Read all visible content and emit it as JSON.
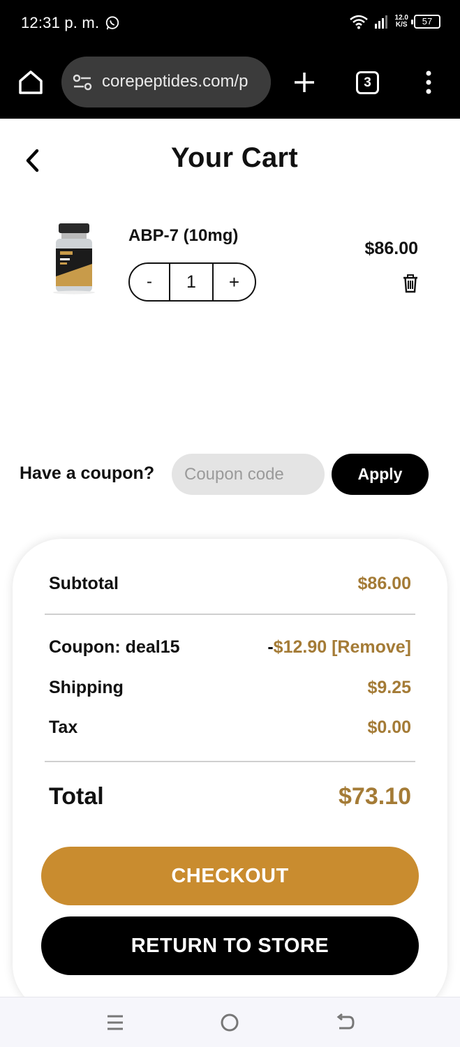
{
  "status_bar": {
    "time": "12:31 p. m.",
    "speed_value": "12.0",
    "speed_unit": "K/S",
    "battery": "57"
  },
  "browser": {
    "url": "corepeptides.com/p",
    "tab_count": "3"
  },
  "header": {
    "title": "Your Cart"
  },
  "cart": {
    "items": [
      {
        "name": "ABP-7 (10mg)",
        "quantity": "1",
        "price": "$86.00",
        "minus": "-",
        "plus": "+"
      }
    ]
  },
  "coupon": {
    "label": "Have a coupon?",
    "placeholder": "Coupon code",
    "apply_label": "Apply"
  },
  "summary": {
    "subtotal_label": "Subtotal",
    "subtotal_value": "$86.00",
    "coupon_label": "Coupon: deal15",
    "coupon_sign": "-",
    "coupon_value": "$12.90 [Remove]",
    "shipping_label": "Shipping",
    "shipping_value": "$9.25",
    "tax_label": "Tax",
    "tax_value": "$0.00",
    "total_label": "Total",
    "total_value": "$73.10",
    "checkout_label": "CHECKOUT",
    "return_label": "RETURN TO STORE"
  },
  "colors": {
    "accent": "#c98c2f",
    "value_text": "#a47b36",
    "chrome_bg": "#000000"
  },
  "icons": [
    "whatsapp-icon",
    "wifi-icon",
    "signal-icon",
    "battery-icon",
    "home-icon",
    "site-settings-icon",
    "new-tab-icon",
    "tabs-icon",
    "more-menu-icon",
    "back-icon",
    "trash-icon",
    "recent-apps-icon",
    "home-nav-icon",
    "back-nav-icon"
  ]
}
